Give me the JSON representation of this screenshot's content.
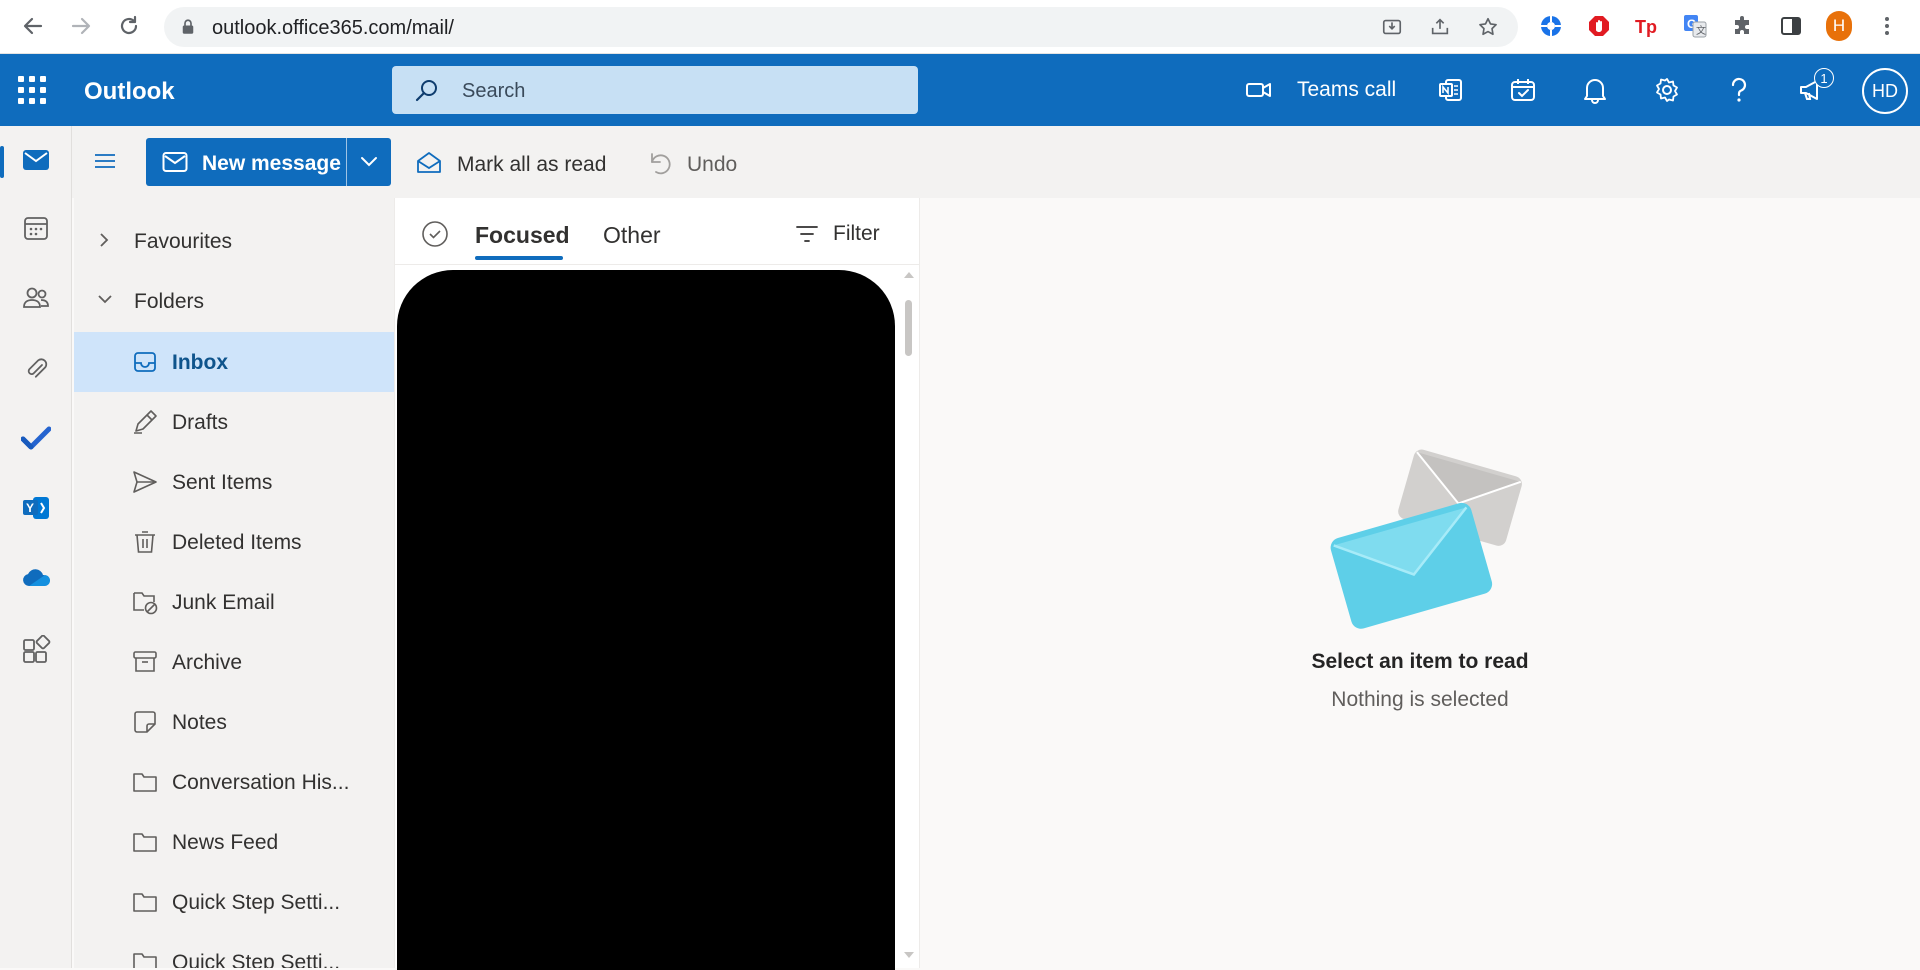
{
  "browser": {
    "url": "outlook.office365.com/mail/",
    "profile_initial": "H",
    "colors": {
      "profile": "#e8710a"
    },
    "icons": [
      "back-icon",
      "forward-icon",
      "reload-icon",
      "lock-icon",
      "install-icon",
      "share-icon",
      "star-icon",
      "extension-grid-icon",
      "adblock-icon",
      "tp-extension-icon",
      "translate-icon",
      "puzzle-icon",
      "sidepanel-icon",
      "kebab-menu-icon"
    ]
  },
  "header": {
    "brand": "Outlook",
    "search_placeholder": "Search",
    "teams_call": "Teams call",
    "notification_count": "1",
    "avatar_initials": "HD",
    "colors": {
      "bar": "#0f6cbd",
      "search": "#c7e0f4"
    }
  },
  "commands": {
    "new_message": "New message",
    "mark_all_read": "Mark all as read",
    "undo": "Undo"
  },
  "folders": {
    "favourites": "Favourites",
    "folders": "Folders",
    "items": [
      {
        "label": "Inbox",
        "icon": "inbox-icon",
        "selected": true
      },
      {
        "label": "Drafts",
        "icon": "pencil-icon"
      },
      {
        "label": "Sent Items",
        "icon": "send-icon"
      },
      {
        "label": "Deleted Items",
        "icon": "trash-icon"
      },
      {
        "label": "Junk Email",
        "icon": "junk-icon"
      },
      {
        "label": "Archive",
        "icon": "archive-icon"
      },
      {
        "label": "Notes",
        "icon": "note-icon"
      },
      {
        "label": "Conversation His...",
        "icon": "folder-icon"
      },
      {
        "label": "News Feed",
        "icon": "folder-icon"
      },
      {
        "label": "Quick Step Setti...",
        "icon": "folder-icon"
      },
      {
        "label": "Quick Step Setti...",
        "icon": "folder-icon"
      }
    ]
  },
  "message_list": {
    "tabs": [
      {
        "label": "Focused",
        "active": true
      },
      {
        "label": "Other"
      }
    ],
    "filter": "Filter"
  },
  "reading_pane": {
    "title": "Select an item to read",
    "subtitle": "Nothing is selected"
  }
}
